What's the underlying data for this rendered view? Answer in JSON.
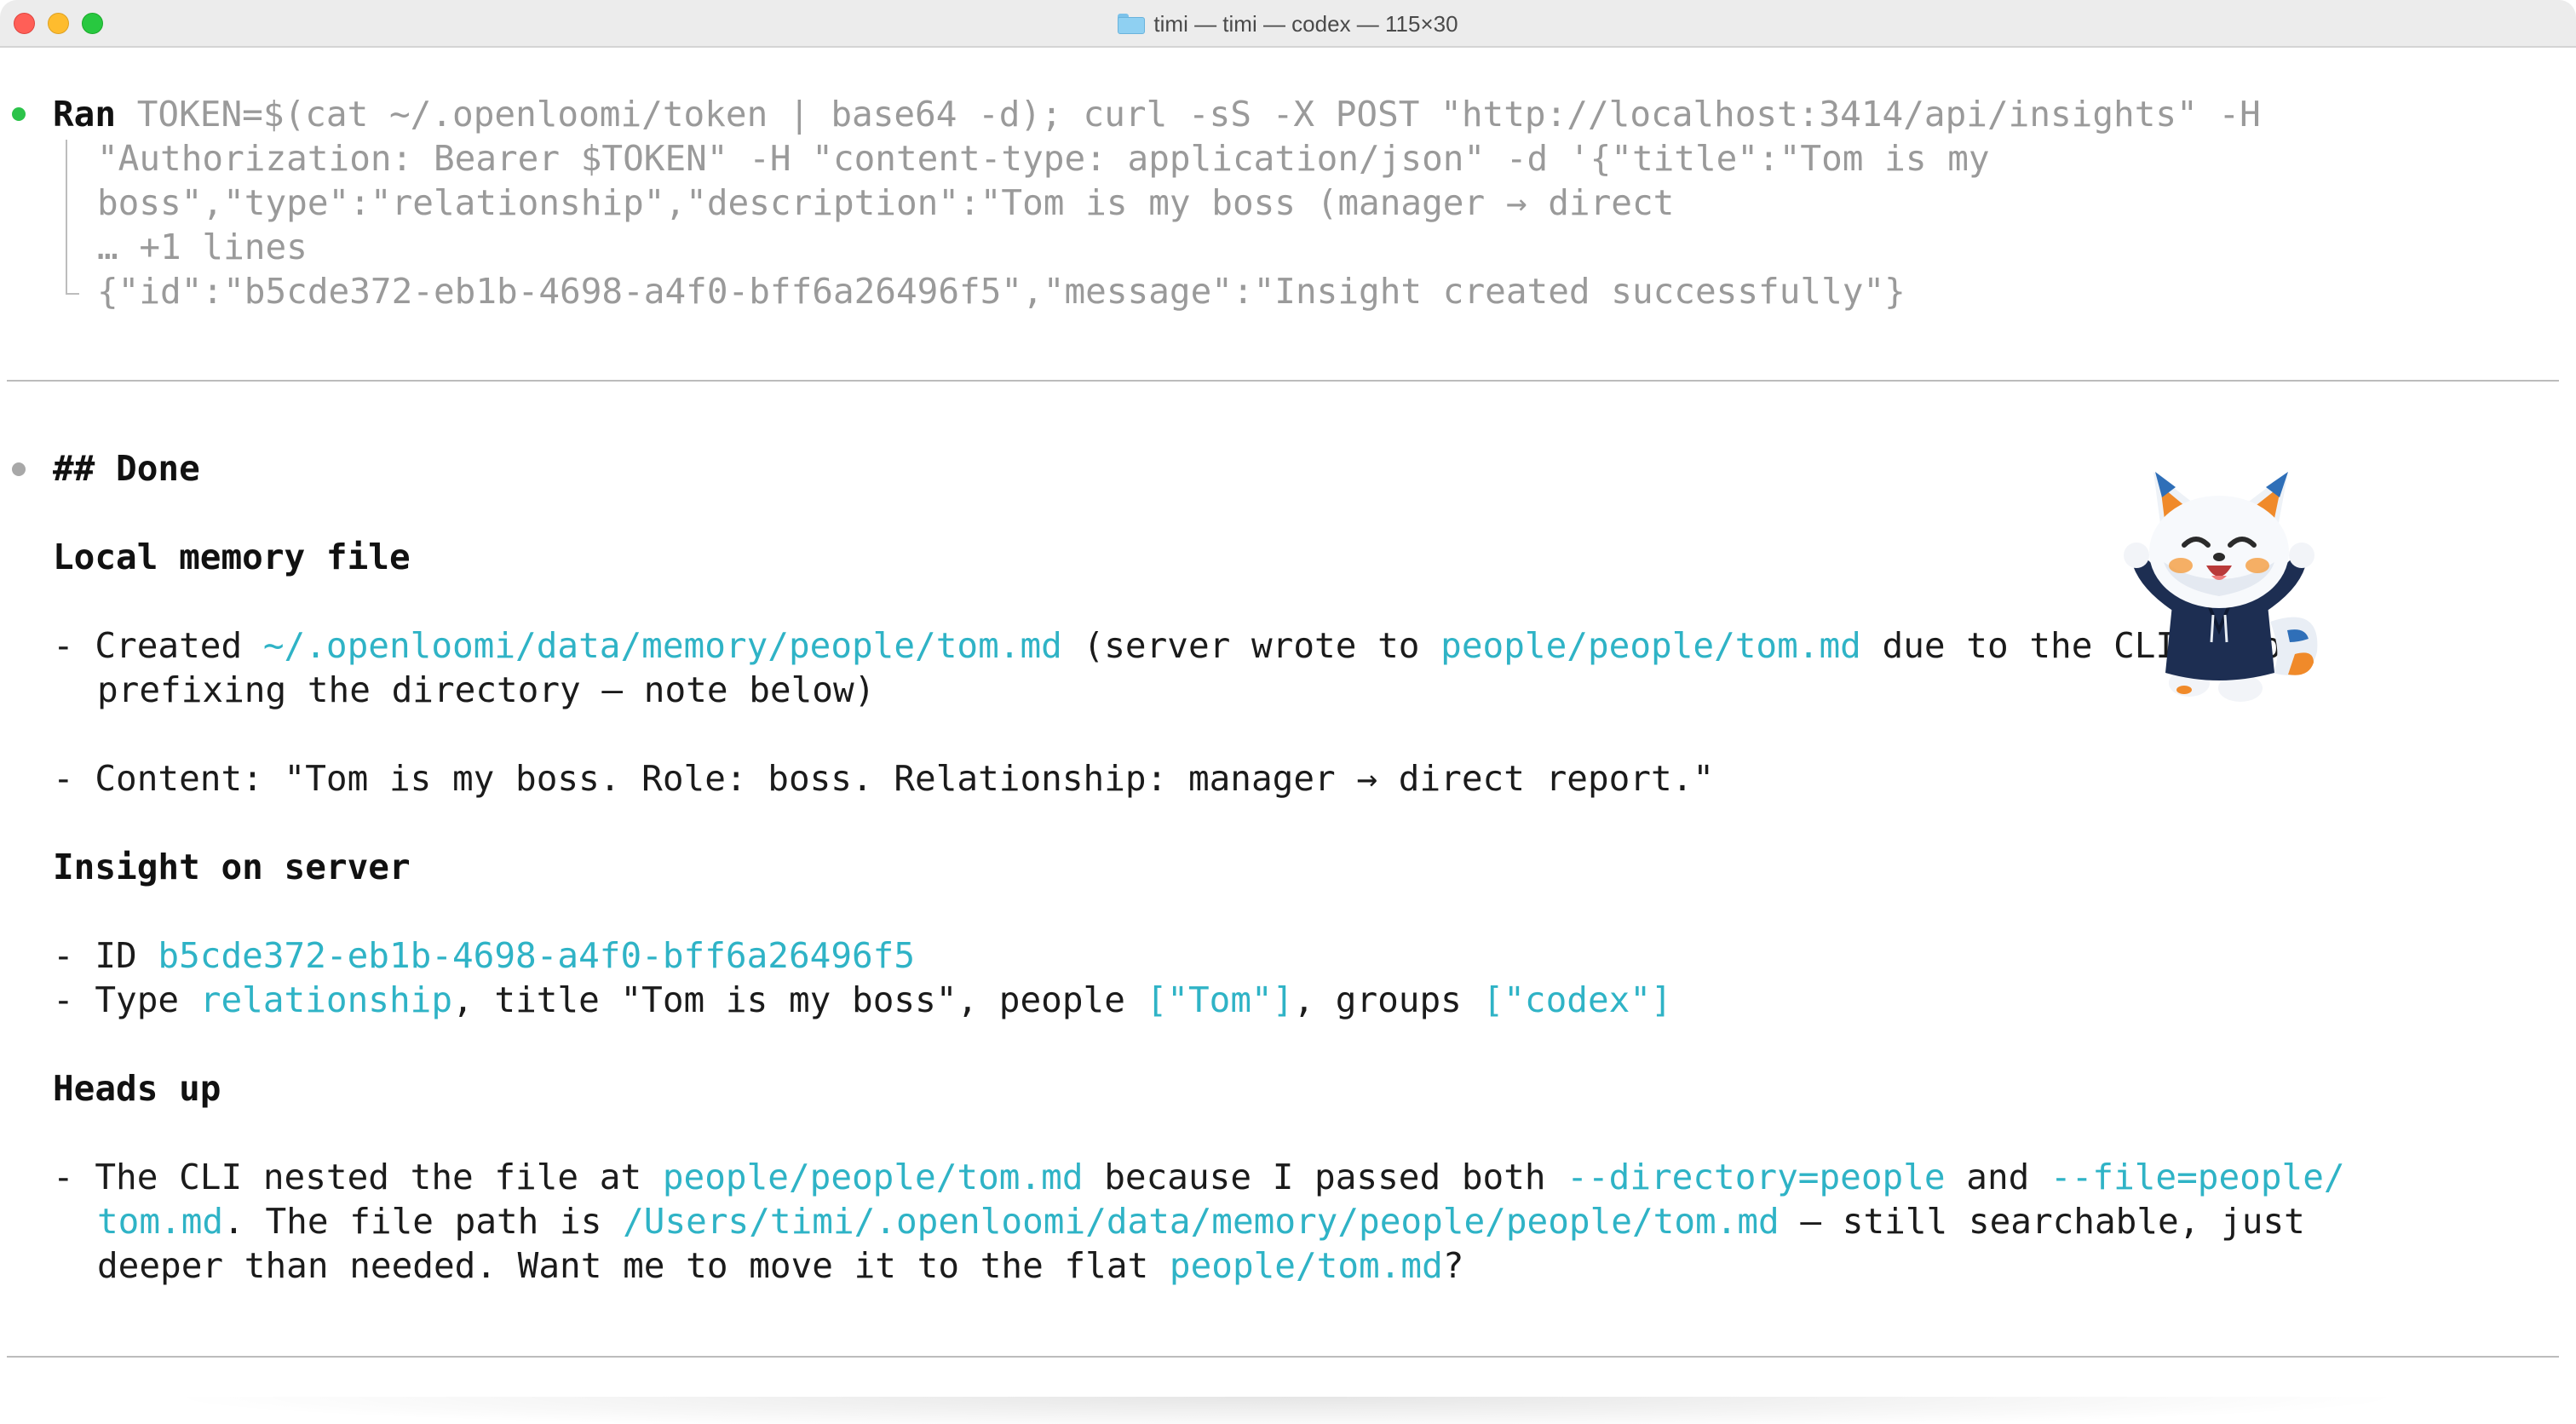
{
  "window": {
    "title": "timi — timi — codex — 115×30",
    "colors": {
      "close": "#ff5f57",
      "minimize": "#febc2e",
      "maximize": "#28c840"
    }
  },
  "theme": {
    "link_color": "#2fb3c6",
    "muted_color": "#9a9a9a",
    "ran_bullet": "#2cc34a"
  },
  "ran": {
    "label": "Ran",
    "cmd_line1": "TOKEN=$(cat ~/.openloomi/token | base64 -d); curl -sS -X POST \"http://localhost:3414/api/insights\" -H",
    "cmd_line2": "\"Authorization: Bearer $TOKEN\" -H \"content-type: application/json\" -d '{\"title\":\"Tom is my",
    "cmd_line3": "boss\",\"type\":\"relationship\",\"description\":\"Tom is my boss (manager → direct",
    "more_lines": "… +1 lines",
    "output": "{\"id\":\"b5cde372-eb1b-4698-a4f0-bff6a26496f5\",\"message\":\"Insight created successfully\"}"
  },
  "done": {
    "heading": "## Done",
    "local_memory": {
      "heading": "Local memory file",
      "item1": {
        "prefix": "- Created ",
        "path": "~/.openloomi/data/memory/people/tom.md",
        "mid": " (server wrote to ",
        "server_path": "people/people/tom.md",
        "suffix": " due to the CLI also",
        "cont": "prefixing the directory — note below)"
      },
      "item2": "- Content: \"Tom is my boss. Role: boss. Relationship: manager → direct report.\""
    },
    "insight": {
      "heading": "Insight on server",
      "id_prefix": "- ID ",
      "id_value": "b5cde372-eb1b-4698-a4f0-bff6a26496f5",
      "type_prefix": "- Type ",
      "type_value": "relationship",
      "title_part": ", title \"Tom is my boss\", people ",
      "people_value": "[\"Tom\"]",
      "groups_part": ", groups ",
      "groups_value": "[\"codex\"]"
    },
    "heads_up": {
      "heading": "Heads up",
      "l1_prefix": "- The CLI nested the file at ",
      "l1_path": "people/people/tom.md",
      "l1_mid": " because I passed both ",
      "l1_flag1": "--directory=people",
      "l1_and": " and ",
      "l1_flag2": "--file=people/",
      "l2_flag2_cont": "tom.md",
      "l2_mid": ". The file path is ",
      "l2_path": "/Users/timi/.openloomi/data/memory/people/people/tom.md",
      "l2_suffix": " — still searchable, just",
      "l3_prefix": "deeper than needed. Want me to move it to the flat ",
      "l3_path": "people/tom.md",
      "l3_suffix": "?"
    }
  }
}
